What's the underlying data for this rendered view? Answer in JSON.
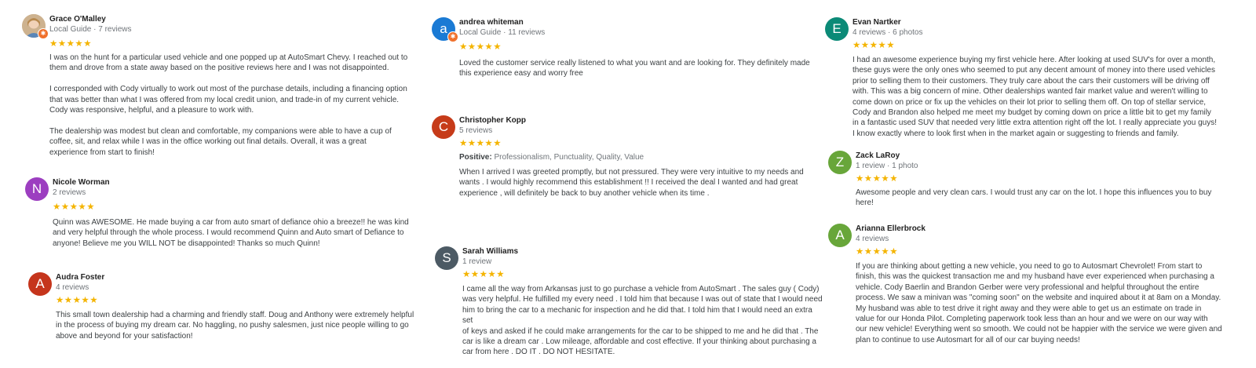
{
  "star_glyphs": "★★★★★",
  "colors": {
    "star": "#f4b400",
    "local_guide_badge": "#f0712c",
    "avatar_nicole": "#9c3ec0",
    "avatar_audra": "#c5351c",
    "avatar_andrea": "#1a7ad4",
    "avatar_christopher": "#c63b19",
    "avatar_sarah": "#4c5a64",
    "avatar_evan": "#0b8a77",
    "avatar_zack": "#68a63a",
    "avatar_arianna": "#68a63a"
  },
  "reviews": {
    "grace": {
      "name": "Grace O'Malley",
      "meta": "Local Guide · 7 reviews",
      "rating": 5,
      "text": "I was on the hunt for a particular used vehicle and one popped up at AutoSmart Chevy.  I reached out to\nthem and drove from a state away based on the positive reviews here and I was not disappointed.\n\nI corresponded with Cody virtually to work out most of the purchase details, including a financing option\nthat was better than what I was offered from my local credit union, and trade-in of my current vehicle.\nCody was responsive, helpful, and a pleasure to work with.\n\nThe dealership was modest but clean and comfortable, my companions were able to have a cup of\ncoffee, sit, and relax while I was in the office working out final details.  Overall, it was a great\nexperience from start to finish!"
    },
    "nicole": {
      "initial": "N",
      "name": "Nicole Worman",
      "meta": "2 reviews",
      "rating": 5,
      "text": "Quinn was AWESOME. He made buying a car from auto smart of defiance ohio a breeze!! he was kind\nand very helpful through the whole process.  I would recommend Quinn and Auto smart of Defiance to\nanyone! Believe me you WILL NOT be disappointed! Thanks so much Quinn!"
    },
    "audra": {
      "initial": "A",
      "name": "Audra Foster",
      "meta": "4 reviews",
      "rating": 5,
      "text": "This small town dealership had a charming and friendly staff. Doug and Anthony were extremely helpful\nin the process of buying my dream car. No haggling, no pushy salesmen, just nice people willing to go\nabove and beyond for your satisfaction!"
    },
    "andrea": {
      "initial": "a",
      "name": "andrea whiteman",
      "meta": "Local Guide · 11 reviews",
      "rating": 5,
      "text": "Loved the customer service really listened to what you want and are looking for. They definitely made\nthis experience easy and worry free"
    },
    "christopher": {
      "initial": "C",
      "name": "Christopher Kopp",
      "meta": "5 reviews",
      "rating": 5,
      "positive_label": "Positive:",
      "positive_value": " Professionalism, Punctuality, Quality, Value",
      "text": "When I arrived I was greeted promptly,  but not pressured.  They were very intuitive to my needs and\nwants .  I would highly recommend this establishment !!    I received the deal I wanted and had great\nexperience ,  will definitely be back to buy another vehicle when its time ."
    },
    "sarah": {
      "initial": "S",
      "name": "Sarah Williams",
      "meta": "1 review",
      "rating": 5,
      "text": "I came all the way from Arkansas just to go purchase a vehicle from AutoSmart . The sales guy ( Cody)\nwas very helpful. He fulfilled my every need . I told him that because I was out of state that I would need\nhim to bring the car to a mechanic for inspection and he did that. I told him that I would need an extra set\nof keys and asked if he could make arrangements for the car to be shipped to me and he did that . The\ncar is like a dream car . Low mileage, affordable and cost effective. If your thinking about purchasing a\ncar from here . DO IT . DO NOT HESITATE."
    },
    "evan": {
      "initial": "E",
      "name": "Evan Nartker",
      "meta": "4 reviews · 6 photos",
      "rating": 5,
      "text": "I had an awesome experience buying my first vehicle here. After looking at used SUV's for over a month,\nthese guys were the only ones who seemed to put any decent amount of money into there used vehicles\nprior to selling them to their customers. They truly care about the cars their customers will be driving off\nwith. This was a big concern of mine. Other dealerships wanted fair market value and weren't willing to\ncome down on price or fix up the vehicles on their lot prior to selling them off. On top of stellar service,\nCody and Brandon also helped me meet my budget by coming down on price a little bit to get my family\nin a fantastic used SUV that needed very little extra attention right off the lot. I really appreciate you guys!\nI know exactly where to look first when in the market again or suggesting to friends and family."
    },
    "zack": {
      "initial": "Z",
      "name": "Zack LaRoy",
      "meta": "1 review · 1 photo",
      "rating": 5,
      "text": "Awesome people and very clean cars. I would trust any car on the lot. I hope this influences you to buy\nhere!"
    },
    "arianna": {
      "initial": "A",
      "name": "Arianna Ellerbrock",
      "meta": "4 reviews",
      "rating": 5,
      "text": "If you are thinking about getting a new vehicle, you need to go to Autosmart Chevrolet! From start to\nfinish, this was the quickest transaction me and my husband have ever experienced when purchasing a\nvehicle. Cody Baerlin and Brandon Gerber were very professional and helpful throughout the entire\nprocess. We saw a minivan was \"coming soon\" on the website and inquired about it at 8am on a Monday.\nMy husband was able to test drive it right away and they were able to get us an estimate on trade in\nvalue for our Honda Pilot.  Completing paperwork took less than an hour and we were on our way with\nour new vehicle! Everything went so smooth. We could not be happier with the service we were given and\nplan to continue to use Autosmart for all of our car buying needs!"
    }
  }
}
